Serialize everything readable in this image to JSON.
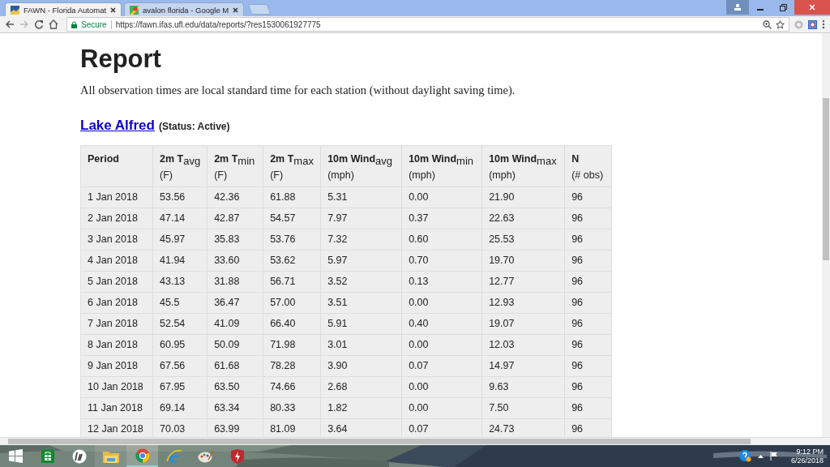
{
  "browser": {
    "tabs": [
      {
        "title": "FAWN - Florida Automat",
        "selected": true
      },
      {
        "title": "avalon florida - Google M",
        "selected": false
      }
    ],
    "security": "Secure",
    "url": "https://fawn.ifas.ufl.edu/data/reports/?res1530061927775"
  },
  "page": {
    "title": "Report",
    "note": "All observation times are local standard time for each station (without daylight saving time).",
    "station": {
      "name": "Lake Alfred",
      "status": "(Status: Active)"
    },
    "table": {
      "columns": [
        {
          "label": "Period"
        },
        {
          "label": "2m T$_{avg}$",
          "unit": "(F)"
        },
        {
          "label": "2m T$_{min}$",
          "unit": "(F)"
        },
        {
          "label": "2m T$_{max}$",
          "unit": "(F)"
        },
        {
          "label": "10m Wind$_{avg}$",
          "unit": "(mph)"
        },
        {
          "label": "10m Wind$_{min}$",
          "unit": "(mph)"
        },
        {
          "label": "10m Wind$_{max}$",
          "unit": "(mph)"
        },
        {
          "label": "N",
          "unit": "(# obs)"
        }
      ],
      "rows": [
        [
          "1 Jan 2018",
          "53.56",
          "42.36",
          "61.88",
          "5.31",
          "0.00",
          "21.90",
          "96"
        ],
        [
          "2 Jan 2018",
          "47.14",
          "42.87",
          "54.57",
          "7.97",
          "0.37",
          "22.63",
          "96"
        ],
        [
          "3 Jan 2018",
          "45.97",
          "35.83",
          "53.76",
          "7.32",
          "0.60",
          "25.53",
          "96"
        ],
        [
          "4 Jan 2018",
          "41.94",
          "33.60",
          "53.62",
          "5.97",
          "0.70",
          "19.70",
          "96"
        ],
        [
          "5 Jan 2018",
          "43.13",
          "31.88",
          "56.71",
          "3.52",
          "0.13",
          "12.77",
          "96"
        ],
        [
          "6 Jan 2018",
          "45.5",
          "36.47",
          "57.00",
          "3.51",
          "0.00",
          "12.93",
          "96"
        ],
        [
          "7 Jan 2018",
          "52.54",
          "41.09",
          "66.40",
          "5.91",
          "0.40",
          "19.07",
          "96"
        ],
        [
          "8 Jan 2018",
          "60.95",
          "50.09",
          "71.98",
          "3.01",
          "0.00",
          "12.03",
          "96"
        ],
        [
          "9 Jan 2018",
          "67.56",
          "61.68",
          "78.28",
          "3.90",
          "0.07",
          "14.97",
          "96"
        ],
        [
          "10 Jan 2018",
          "67.95",
          "63.50",
          "74.66",
          "2.68",
          "0.00",
          "9.63",
          "96"
        ],
        [
          "11 Jan 2018",
          "69.14",
          "63.34",
          "80.33",
          "1.82",
          "0.00",
          "7.50",
          "96"
        ],
        [
          "12 Jan 2018",
          "70.03",
          "63.99",
          "81.09",
          "3.64",
          "0.07",
          "24.73",
          "96"
        ]
      ]
    }
  },
  "taskbar": {
    "clock": {
      "time": "9:12 PM",
      "date": "6/26/2018"
    }
  }
}
